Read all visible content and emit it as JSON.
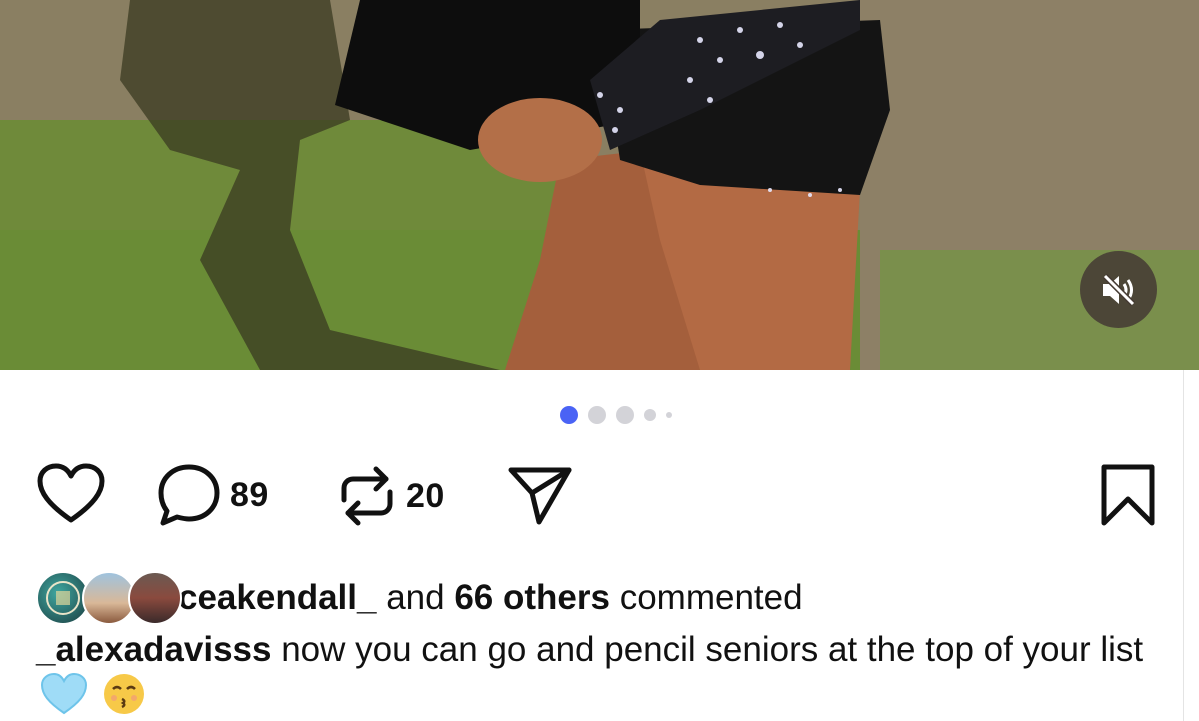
{
  "media": {
    "type": "video",
    "mute_icon": "speaker-muted-icon",
    "carousel": {
      "total": 5,
      "active_index": 0
    },
    "colors": {
      "dot_active": "#4a63f5",
      "dot_inactive": "#d3d3d8"
    }
  },
  "actions": {
    "like_icon": "heart-outline-icon",
    "comment_icon": "comment-bubble-icon",
    "comment_count": "89",
    "repost_icon": "repost-icon",
    "repost_count": "20",
    "share_icon": "send-paper-plane-icon",
    "bookmark_icon": "bookmark-icon"
  },
  "comments_summary": {
    "username": "ceakendall_",
    "connector": "and",
    "others": "66 others",
    "suffix": "commented"
  },
  "top_comment": {
    "username": "_alexadavisss",
    "text": "now you can go and pencil seniors at the top of your list",
    "emojis": [
      "light-blue-heart",
      "kissing-face"
    ]
  }
}
